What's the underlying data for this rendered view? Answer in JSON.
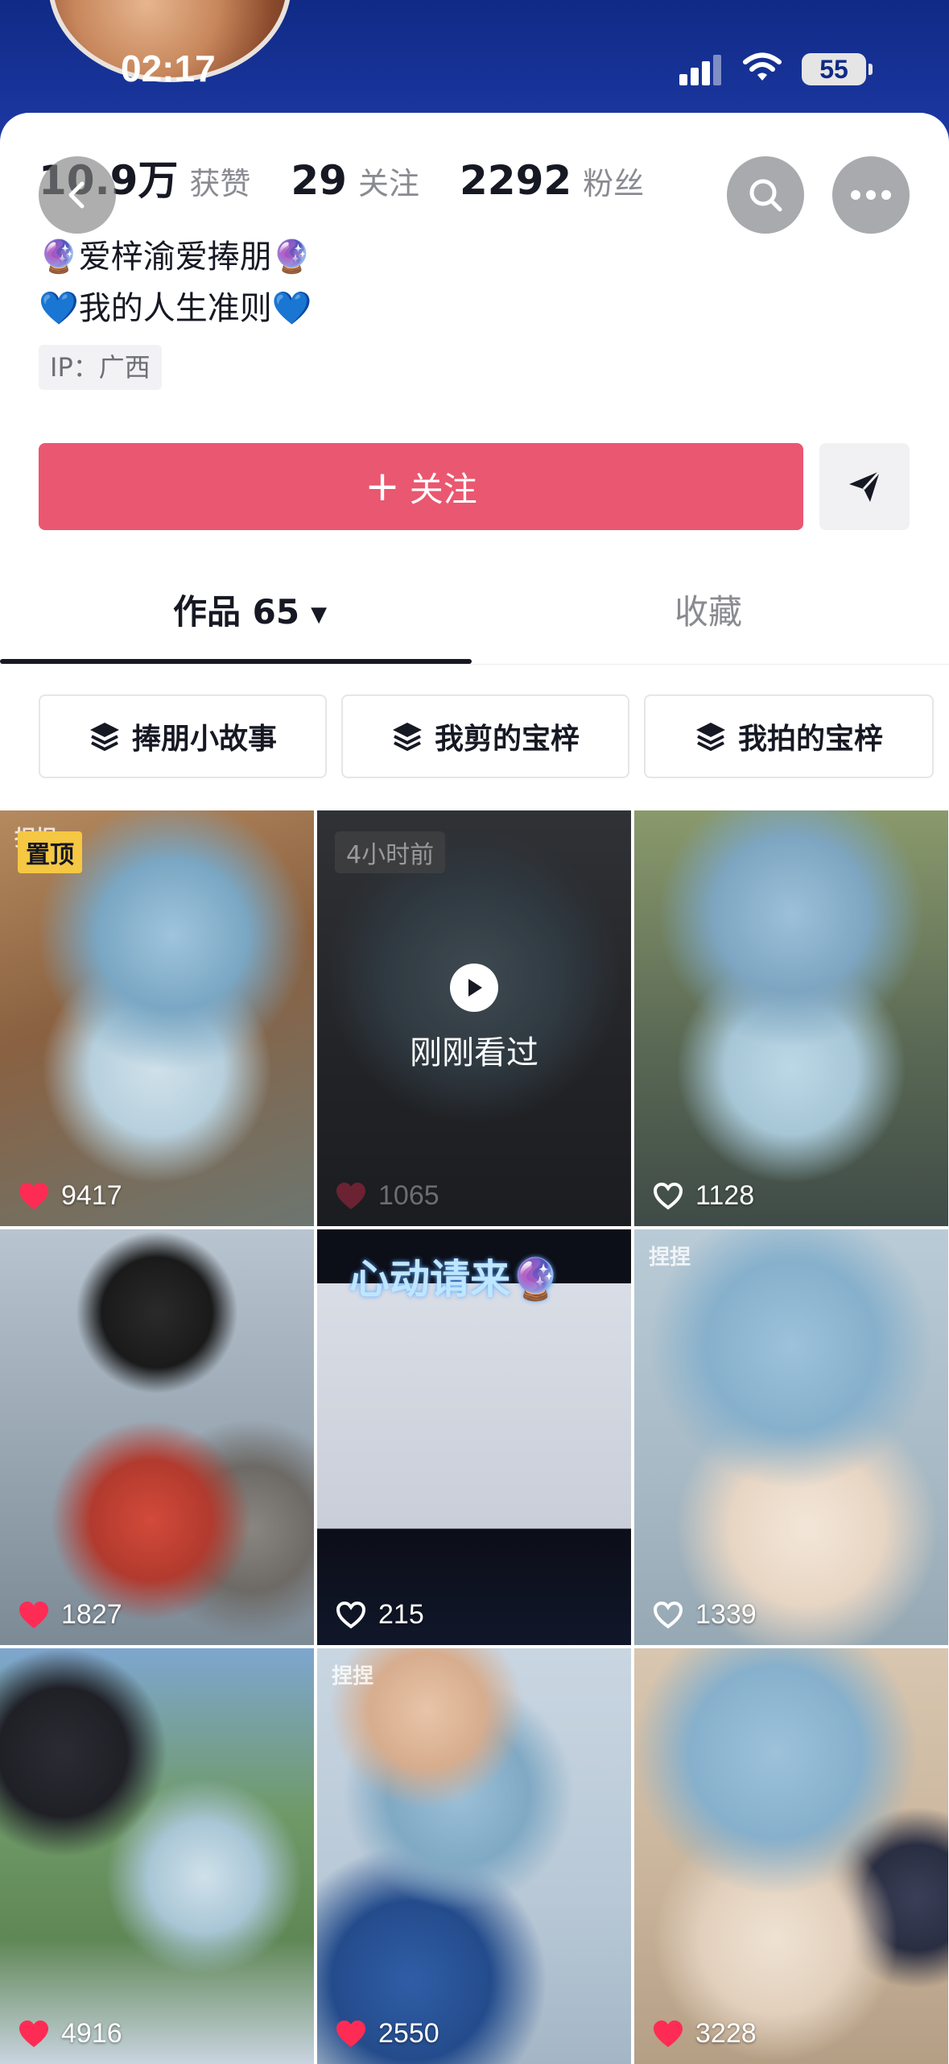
{
  "status_bar": {
    "time": "02:17",
    "battery": "55"
  },
  "profile": {
    "stats": [
      {
        "value": "10.9万",
        "label": "获赞"
      },
      {
        "value": "29",
        "label": "关注"
      },
      {
        "value": "2292",
        "label": "粉丝"
      }
    ],
    "bio_line1": "🔮爱梓渝爱捧朋🔮",
    "bio_line2": "💙我的人生准则💙",
    "ip": "IP：广西",
    "follow_label": "关注"
  },
  "tabs": {
    "works_label": "作品 65",
    "favorites_label": "收藏"
  },
  "collections": [
    {
      "label": "捧朋小故事"
    },
    {
      "label": "我剪的宝梓"
    },
    {
      "label": "我拍的宝梓"
    }
  ],
  "grid": {
    "pinned_badge": "置顶",
    "recent_badge": "4小时前",
    "watched_label": "刚刚看过",
    "promo_title": "心动请来🔮",
    "watermark": "捏捏",
    "items": [
      {
        "likes": "9417",
        "liked": true
      },
      {
        "likes": "1065",
        "liked": true
      },
      {
        "likes": "1128",
        "liked": false
      },
      {
        "likes": "1827",
        "liked": true
      },
      {
        "likes": "215",
        "liked": false
      },
      {
        "likes": "1339",
        "liked": false
      },
      {
        "likes": "4916",
        "liked": true
      },
      {
        "likes": "2550",
        "liked": true
      },
      {
        "likes": "3228",
        "liked": true
      }
    ]
  },
  "colors": {
    "header_bg": "#102a86",
    "follow_button": "#ea5770",
    "pin_badge": "#f5c743",
    "like_red": "#fe2c55"
  }
}
